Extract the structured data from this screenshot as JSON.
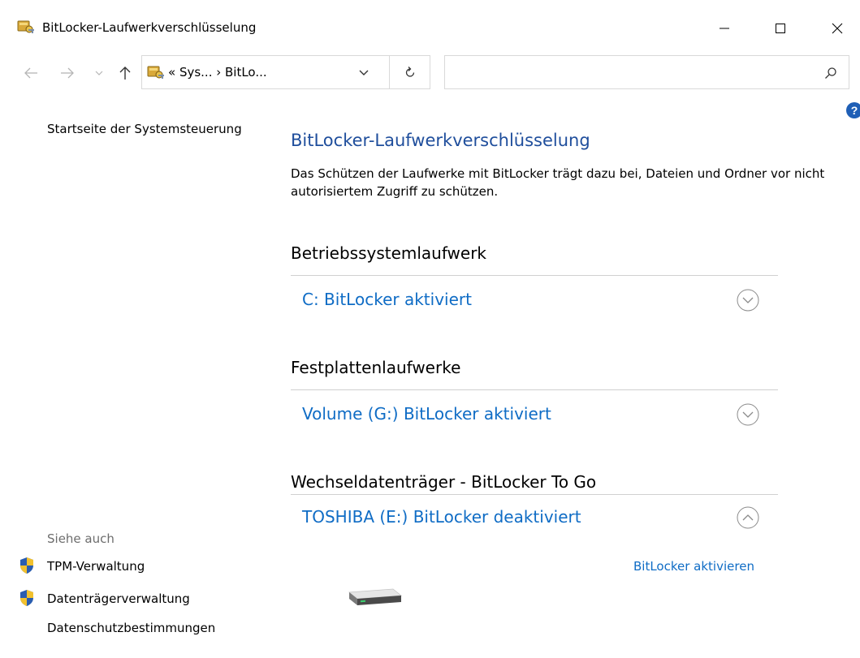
{
  "window": {
    "title": "BitLocker-Laufwerkverschlüsselung",
    "icon": "bitlocker-key-icon"
  },
  "address_bar": {
    "path": "« Sys...  ›  BitLo...",
    "search_placeholder": ""
  },
  "sidebar": {
    "home_link": "Startseite der Systemsteuerung",
    "see_also_label": "Siehe auch",
    "links": [
      {
        "label": "TPM-Verwaltung",
        "icon": "uac-shield-icon"
      },
      {
        "label": "Datenträgerverwaltung",
        "icon": "uac-shield-icon"
      },
      {
        "label": "Datenschutzbestimmungen",
        "icon": ""
      }
    ]
  },
  "main": {
    "title": "BitLocker-Laufwerkverschlüsselung",
    "description": "Das Schützen der Laufwerke mit BitLocker trägt dazu bei, Dateien und Ordner vor nicht autorisiertem Zugriff zu schützen.",
    "sections": [
      {
        "heading": "Betriebssystemlaufwerk",
        "drive": "C: BitLocker aktiviert",
        "expanded": false
      },
      {
        "heading": "Festplattenlaufwerke",
        "drive": "Volume (G:) BitLocker aktiviert",
        "expanded": false
      },
      {
        "heading": "Wechseldatenträger - BitLocker To Go",
        "drive": "TOSHIBA (E:) BitLocker deaktiviert",
        "expanded": true
      }
    ],
    "activate_link": "BitLocker aktivieren"
  },
  "colors": {
    "link_blue": "#0f6cc5",
    "title_blue": "#1f4e9c",
    "help_blue": "#1f5fb6"
  }
}
